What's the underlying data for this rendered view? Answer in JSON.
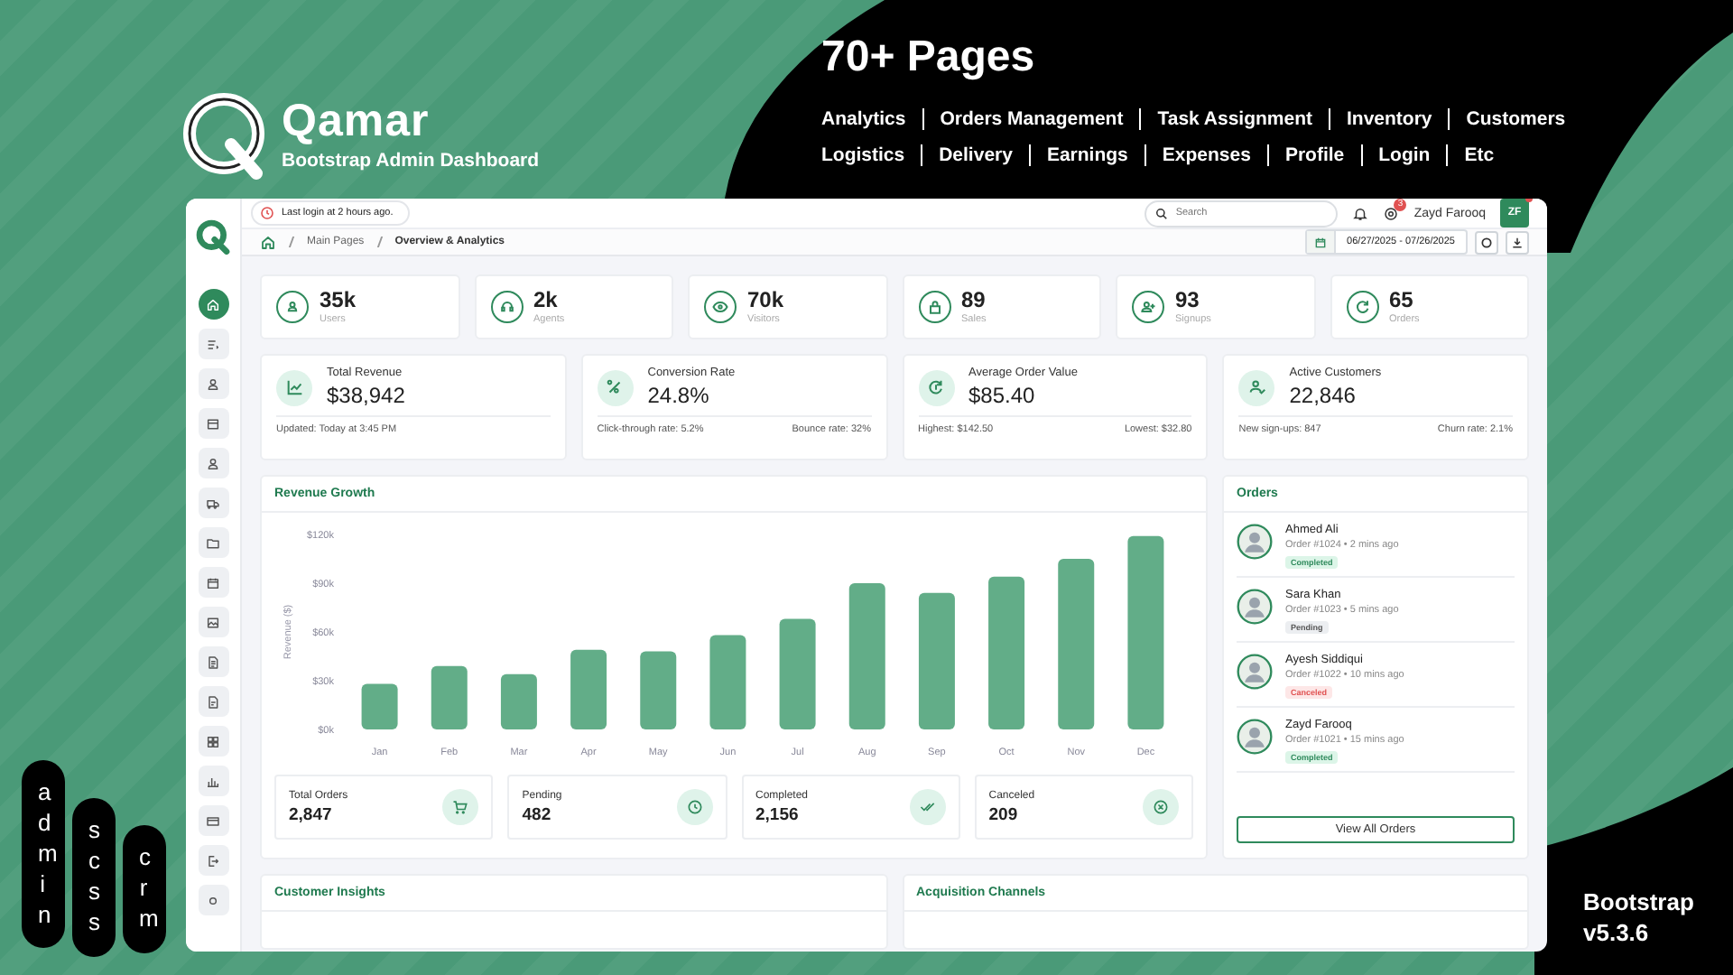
{
  "brand": {
    "name": "Qamar",
    "tagline": "Bootstrap Admin Dashboard"
  },
  "headline": "70+ Pages",
  "page_rows": [
    [
      "Analytics",
      "Orders Management",
      "Task Assignment",
      "Inventory",
      "Customers"
    ],
    [
      "Logistics",
      "Delivery",
      "Earnings",
      "Expenses",
      "Profile",
      "Login",
      "Etc"
    ]
  ],
  "tags": [
    "admin",
    "scss",
    "crm"
  ],
  "footer_lines": [
    "Bootstrap",
    "v5.3.6"
  ],
  "dashboard": {
    "last_login": "Last login at 2 hours ago.",
    "search": {
      "placeholder": "Search"
    },
    "notification_count": "3",
    "user": {
      "name": "Zayd Farooq",
      "initials": "ZF",
      "online": true
    },
    "breadcrumb": [
      "Main Pages",
      "Overview & Analytics"
    ],
    "date_range": "06/27/2025 - 07/26/2025",
    "sidebar": [
      {
        "selected": true
      },
      {
        "selected": false
      },
      {
        "selected": false
      },
      {
        "selected": false
      },
      {
        "selected": false
      },
      {
        "selected": false
      },
      {
        "selected": false
      },
      {
        "selected": false
      },
      {
        "selected": false
      },
      {
        "selected": false
      },
      {
        "selected": false
      },
      {
        "selected": false
      },
      {
        "selected": false
      },
      {
        "selected": false
      },
      {
        "selected": false
      },
      {
        "selected": false
      }
    ],
    "stats": [
      {
        "value": "35k",
        "label": "Users"
      },
      {
        "value": "2k",
        "label": "Agents"
      },
      {
        "value": "70k",
        "label": "Visitors"
      },
      {
        "value": "89",
        "label": "Sales"
      },
      {
        "value": "93",
        "label": "Signups"
      },
      {
        "value": "65",
        "label": "Orders"
      }
    ],
    "metrics": [
      {
        "title": "Total Revenue",
        "value": "$38,942",
        "foot_left": "Updated: Today at 3:45 PM"
      },
      {
        "title": "Conversion Rate",
        "value": "24.8%",
        "foot_left": "Click-through rate: 5.2%",
        "foot_right": "Bounce rate: 32%"
      },
      {
        "title": "Average Order Value",
        "value": "$85.40",
        "foot_left": "Highest: $142.50",
        "foot_right": "Lowest: $32.80"
      },
      {
        "title": "Active Customers",
        "value": "22,846",
        "foot_left": "New sign-ups: 847",
        "foot_right": "Churn rate: 2.1%"
      }
    ],
    "revenue": {
      "title": "Revenue Growth",
      "chart_data": {
        "type": "bar",
        "ylabel": "Revenue ($)",
        "categories": [
          "Jan",
          "Feb",
          "Mar",
          "Apr",
          "May",
          "Jun",
          "Jul",
          "Aug",
          "Sep",
          "Oct",
          "Nov",
          "Dec"
        ],
        "values": [
          28000,
          39000,
          34000,
          49000,
          48000,
          58000,
          68000,
          90000,
          84000,
          94000,
          105000,
          119000
        ],
        "ylim": [
          0,
          120000
        ],
        "yticks": [
          {
            "value": 0,
            "label": "$0k"
          },
          {
            "value": 30000,
            "label": "$30k"
          },
          {
            "value": 60000,
            "label": "$60k"
          },
          {
            "value": 90000,
            "label": "$90k"
          },
          {
            "value": 120000,
            "label": "$120k"
          }
        ]
      },
      "summary": [
        {
          "label": "Total Orders",
          "value": "2,847"
        },
        {
          "label": "Pending",
          "value": "482"
        },
        {
          "label": "Completed",
          "value": "2,156"
        },
        {
          "label": "Canceled",
          "value": "209"
        }
      ]
    },
    "orders": {
      "title": "Orders",
      "items": [
        {
          "name": "Ahmed Ali",
          "meta": "Order #1024 • 2 mins ago",
          "status": "Completed",
          "kind": "completed"
        },
        {
          "name": "Sara Khan",
          "meta": "Order #1023 • 5 mins ago",
          "status": "Pending",
          "kind": "pending"
        },
        {
          "name": "Ayesh Siddiqui",
          "meta": "Order #1022 • 10 mins ago",
          "status": "Canceled",
          "kind": "canceled"
        },
        {
          "name": "Zayd Farooq",
          "meta": "Order #1021 • 15 mins ago",
          "status": "Completed",
          "kind": "completed"
        }
      ],
      "button": "View All Orders"
    },
    "bottom_cards": [
      "Customer Insights",
      "Acquisition Channels"
    ]
  }
}
